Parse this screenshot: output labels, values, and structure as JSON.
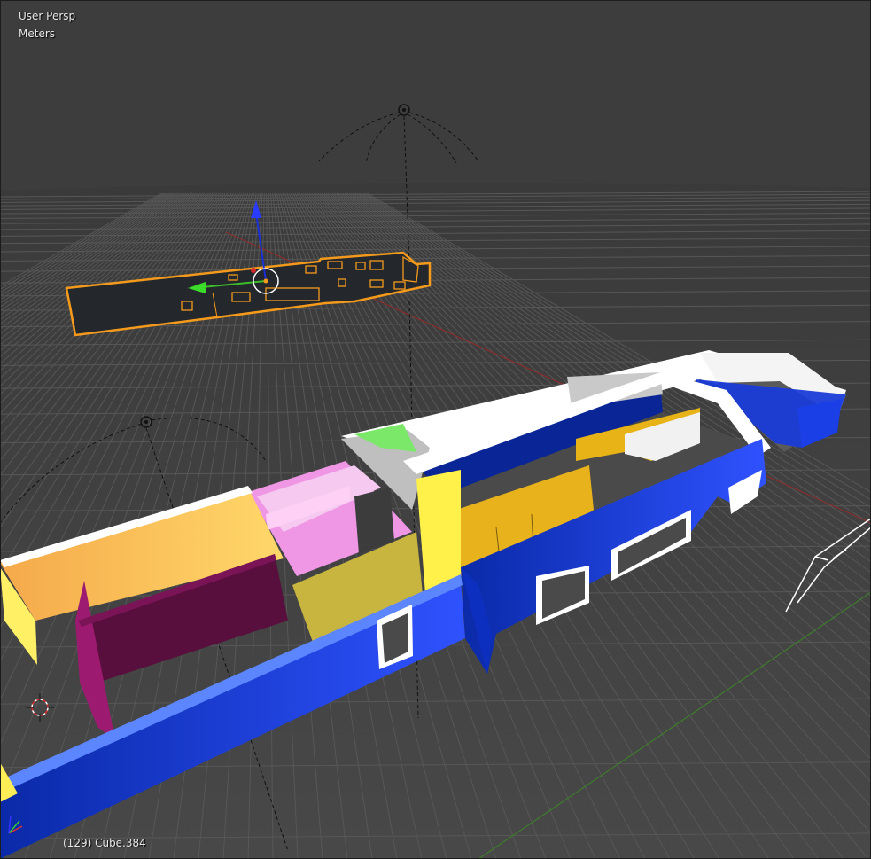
{
  "viewport": {
    "view_name": "User Persp",
    "units": "Meters",
    "object_info": "(129) Cube.384"
  },
  "colors": {
    "background_top": "#3e3e3e",
    "floor": "#454545",
    "grid_line": "#555555",
    "axis_x": "#8c2b2b",
    "axis_y": "#3b7a2a",
    "selection": "#f39a1d",
    "wall_blue": "#1d3bd6",
    "wall_white": "#ffffff",
    "room_yellow": "#e8b820",
    "room_pink": "#ef9be6",
    "room_purple": "#5a0f3d"
  },
  "icons": [
    "lamp-icon",
    "camera-icon",
    "3d-cursor-icon",
    "axis-gizmo-icon",
    "transform-manipulator-icon"
  ]
}
